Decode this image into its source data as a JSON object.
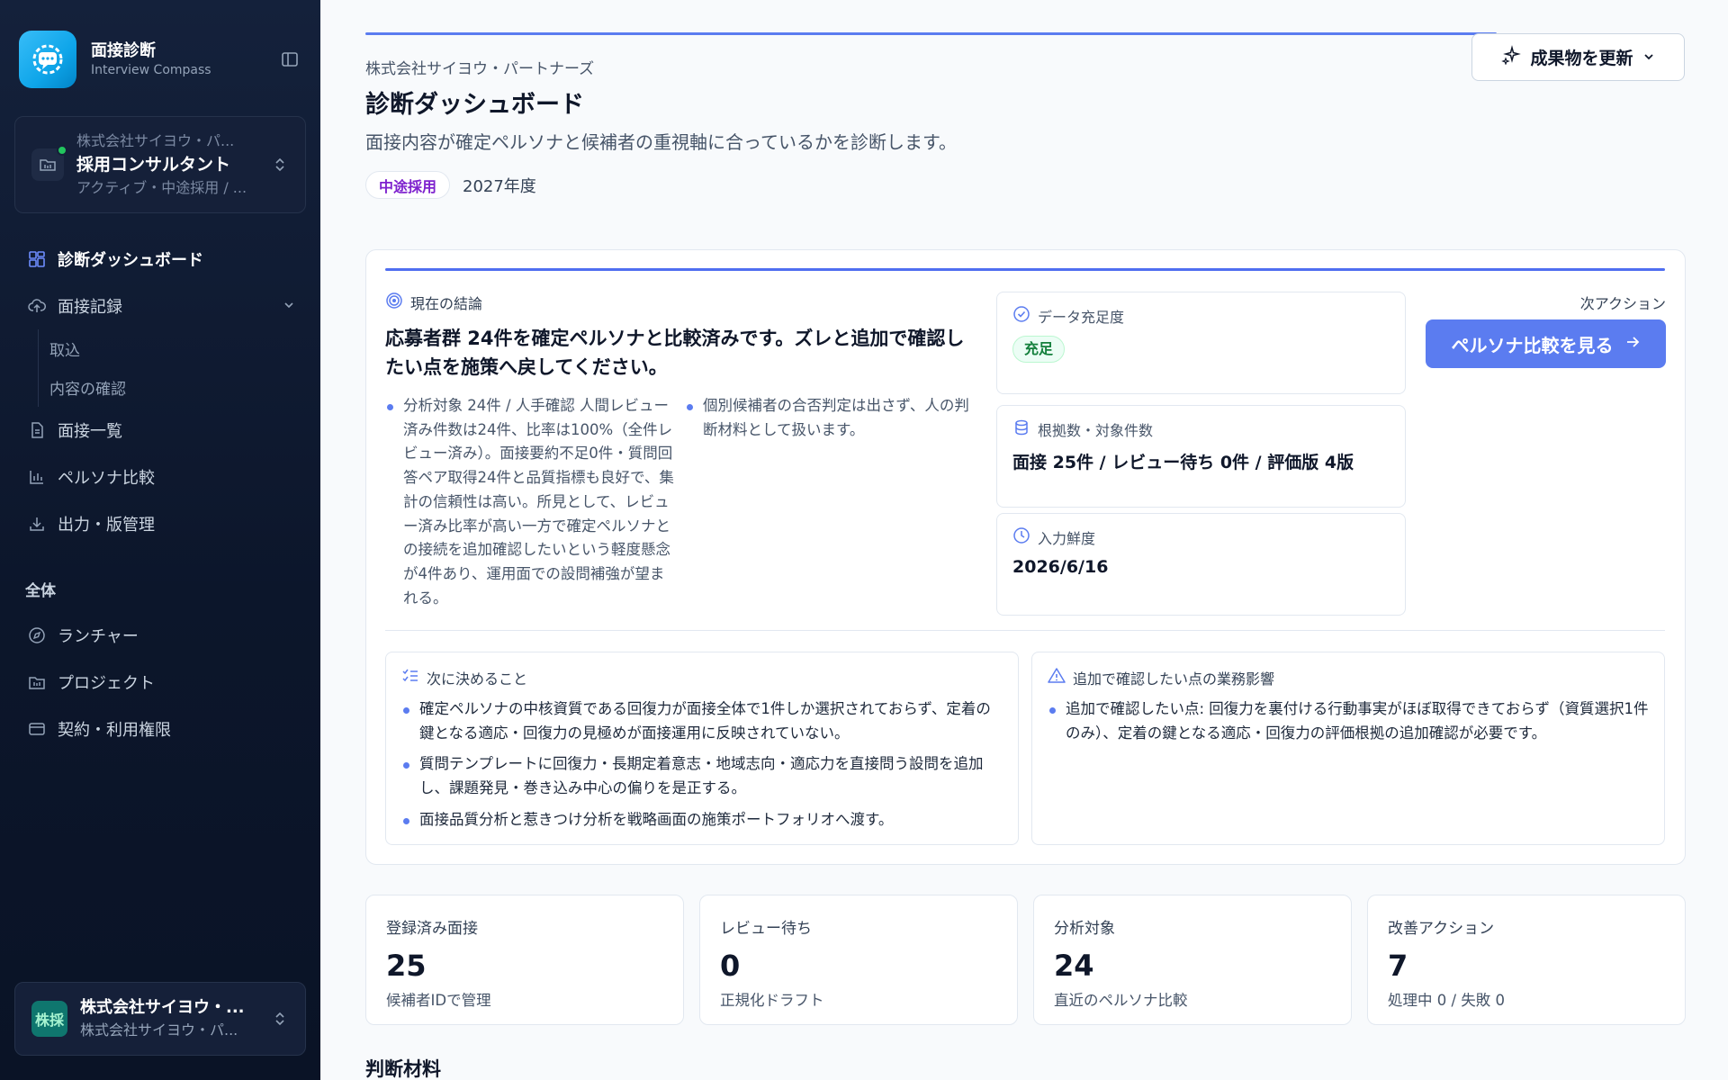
{
  "brand": {
    "name": "面接診断",
    "sub": "Interview Compass"
  },
  "project": {
    "company": "株式会社サイヨウ・パ...",
    "role": "採用コンサルタント",
    "status": "アクティブ・中途採用 / ..."
  },
  "nav": {
    "dashboard": "診断ダッシュボード",
    "records": "面接記録",
    "records_sub": [
      "取込",
      "内容の確認"
    ],
    "list": "面接一覧",
    "persona": "ペルソナ比較",
    "output": "出力・版管理",
    "section_all": "全体",
    "launcher": "ランチャー",
    "projects": "プロジェクト",
    "contract": "契約・利用権限"
  },
  "user": {
    "avatar": "株採",
    "name": "株式会社サイヨウ・...",
    "org": "株式会社サイヨウ・パ..."
  },
  "header": {
    "company": "株式会社サイヨウ・パートナーズ",
    "title": "診断ダッシュボード",
    "description": "面接内容が確定ペルソナと候補者の重視軸に合っているかを診断します。",
    "tag": "中途採用",
    "year": "2027年度",
    "update_button": "成果物を更新"
  },
  "conclusion": {
    "label": "現在の結論",
    "title": "応募者群 24件を確定ペルソナと比較済みです。ズレと追加で確認したい点を施策へ戻してください。",
    "bullet_1": "分析対象 24件 / 人手確認 人間レビュー済み件数は24件、比率は100%（全件レビュー済み）。面接要約不足0件・質問回答ペア取得24件と品質指標も良好で、集計の信頼性は高い。所見として、レビュー済み比率が高い一方で確定ペルソナとの接続を追加確認したいという軽度懸念が4件あり、運用面での設問補強が望まれる。",
    "bullet_2": "個別候補者の合否判定は出さず、人の判断材料として扱います。"
  },
  "metrics": {
    "sufficiency": {
      "label": "データ充足度",
      "badge": "充足"
    },
    "basis": {
      "label": "根拠数・対象件数",
      "value": "面接 25件 / レビュー待ち 0件 / 評価版 4版"
    },
    "freshness": {
      "label": "入力鮮度",
      "value": "2026/6/16"
    }
  },
  "next_action": {
    "label": "次アクション",
    "button": "ペルソナ比較を見る"
  },
  "decide": {
    "label": "次に決めること",
    "items": [
      "確定ペルソナの中核資質である回復力が面接全体で1件しか選択されておらず、定着の鍵となる適応・回復力の見極めが面接運用に反映されていない。",
      "質問テンプレートに回復力・長期定着意志・地域志向・適応力を直接問う設問を追加し、課題発見・巻き込み中心の偏りを是正する。",
      "面接品質分析と惹きつけ分析を戦略画面の施策ポートフォリオへ渡す。"
    ]
  },
  "impact": {
    "label": "追加で確認したい点の業務影響",
    "items": [
      "追加で確認したい点: 回復力を裏付ける行動事実がほぼ取得できておらず（資質選択1件のみ）、定着の鍵となる適応・回復力の評価根拠の追加確認が必要です。"
    ]
  },
  "stats": [
    {
      "label": "登録済み面接",
      "value": "25",
      "sub": "候補者IDで管理"
    },
    {
      "label": "レビュー待ち",
      "value": "0",
      "sub": "正規化ドラフト"
    },
    {
      "label": "分析対象",
      "value": "24",
      "sub": "直近のペルソナ比較"
    },
    {
      "label": "改善アクション",
      "value": "7",
      "sub": "処理中 0 / 失敗 0"
    }
  ],
  "section_title": "判断材料",
  "colors": {
    "accent": "#5b7cf0",
    "sidebar": "#0f1a30",
    "success": "#15803d",
    "tag": "#7e22ce"
  }
}
